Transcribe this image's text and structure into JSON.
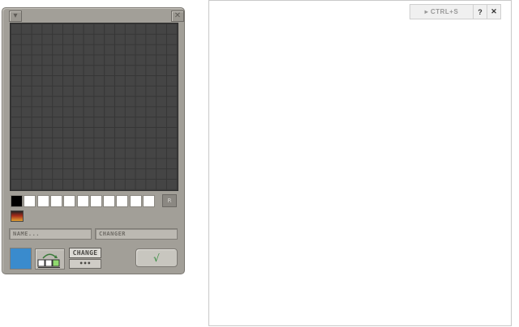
{
  "editor": {
    "title_bar": {
      "menu_icon": "chevron-down-icon",
      "close_icon": "close-icon",
      "close_glyph": "✕"
    },
    "grid": {
      "columns": 16,
      "rows": 16
    },
    "palette": {
      "swatch_colors": [
        "#000000",
        "#ffffff",
        "#ffffff",
        "#ffffff",
        "#ffffff",
        "#ffffff",
        "#ffffff",
        "#ffffff",
        "#ffffff",
        "#ffffff",
        "#ffffff"
      ],
      "reset_label": "R"
    },
    "name_input": {
      "placeholder": "NAME..."
    },
    "changer_field": {
      "value": "CHANGER"
    },
    "selected_color": "#3a8bcd",
    "change_button_label": "CHANGE",
    "more_button_label": "•••",
    "ok_glyph": "√"
  },
  "canvas": {
    "ctrl_button_label": "▸ CTRL+S",
    "help_label": "?",
    "close_label": "✕"
  }
}
